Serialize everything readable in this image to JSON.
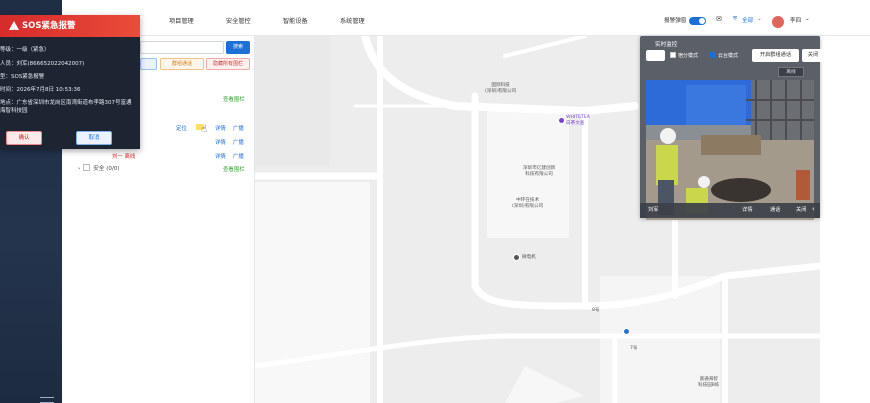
{
  "topbar": {
    "menu": [
      "项目管理",
      "安全管控",
      "智能设备",
      "系统管理"
    ],
    "alarm_label": "报警弹窗",
    "scope_label": "全部",
    "user_name": "李四",
    "avatar_text": "",
    "accent_color": "#1d6fd8"
  },
  "panel": {
    "search_button": "搜索",
    "chips": [
      "",
      "群组通话",
      "隐藏所有围栏"
    ],
    "row_links": {
      "show_fence_1": "查看围栏",
      "locate": "定位",
      "detail": "详情",
      "broadcast": "广播",
      "show_fence_2": "查看围栏"
    },
    "partial_text": "刘一  离线",
    "tree_item": "安全 (0/0)"
  },
  "sos": {
    "title": "SOS紧急报警",
    "level": "等级：一级（紧急）",
    "person": "人员：刘军(866652022042007)",
    "type": "型：SOS紧急报警",
    "time": "时间：2026年7月8日 10:53:36",
    "address": "地点：广东省深圳市龙岗区南湾街道布李路307号富通海智科技园",
    "confirm": "确认",
    "cancel": "取消"
  },
  "monitor": {
    "title": "实时监控",
    "mode1": "宿分模式",
    "mode2": "云台模式",
    "open_call": "开启群组通话",
    "close": "关闭",
    "status_pill": "离线",
    "footer_name": "刘军",
    "footer_detail": "详情",
    "footer_call": "通话",
    "footer_close": "关闭"
  },
  "map": {
    "labels": {
      "a": "国际科技\n(深圳)有限公司",
      "b": "WHITETEA\n白茶文查",
      "c": "深圳市亿建创新\n科技有限公司",
      "d": "中环在技术\n(深圳)有限公司",
      "e": "微电机",
      "f": "8号",
      "g": "7号",
      "h": "富通海智\n科技园B栋"
    }
  }
}
